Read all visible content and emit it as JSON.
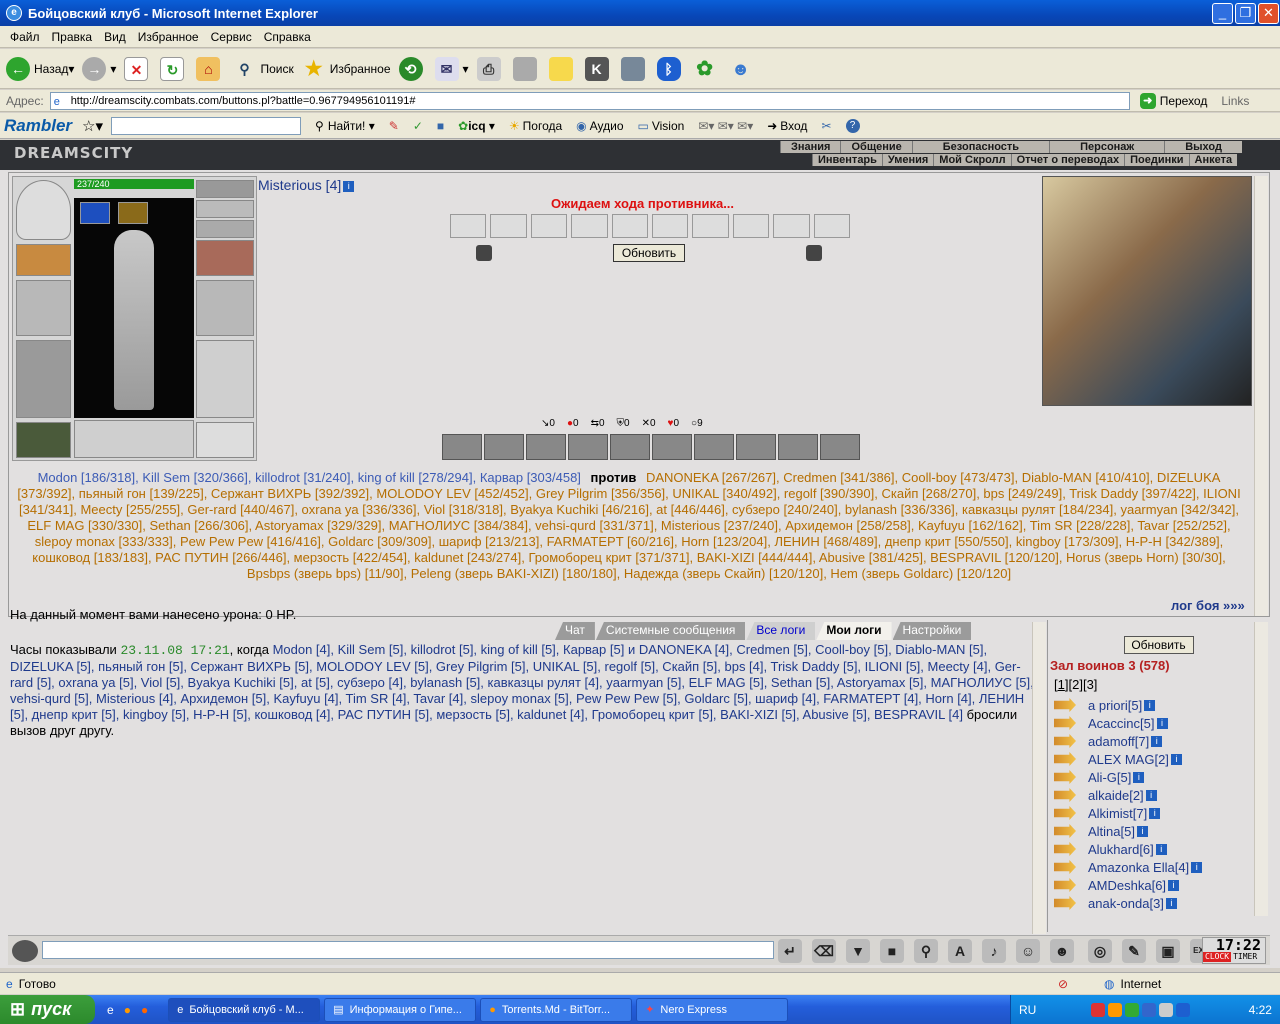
{
  "window": {
    "title": "Бойцовский клуб - Microsoft Internet Explorer"
  },
  "menu": [
    "Файл",
    "Правка",
    "Вид",
    "Избранное",
    "Сервис",
    "Справка"
  ],
  "toolbar": {
    "back": "Назад",
    "search": "Поиск",
    "favorites": "Избранное"
  },
  "address": {
    "label": "Адрес:",
    "url": "http://dreamscity.combats.com/buttons.pl?battle=0.967794956101191#",
    "go": "Переход",
    "links": "Links"
  },
  "rambler": {
    "logo": "Rambler",
    "find": "Найти!",
    "icq": "icq",
    "weather": "Погода",
    "audio": "Аудио",
    "vision": "Vision",
    "login": "Вход"
  },
  "game": {
    "logo": "DREAMSCITY",
    "nav_top": [
      "Знания",
      "Общение",
      "Безопасность",
      "Персонаж",
      "Выход"
    ],
    "nav_bottom": [
      "Инвентарь",
      "Умения",
      "Мой Скролл",
      "Отчет о переводах",
      "Поединки",
      "Анкета"
    ],
    "hp": "237/240",
    "opponent": "Misterious [4]",
    "waiting": "Ожидаем хода противника...",
    "refresh": "Обновить",
    "stats": [
      "0",
      "0",
      "0",
      "0",
      "0",
      "0",
      "9"
    ],
    "team1": "Modon [186/318], Kill Sem [320/366], killodrot [31/240], king of kill [278/294], Карвар [303/458]",
    "vs": "против",
    "team2": "DANONEKA [267/267], Credmen [341/386], Cooll-boy [473/473], Diablo-MAN [410/410], DIZELUKA [373/392], пьяный гон [139/225], Сержант ВИХРЬ [392/392], MOLODOY LEV [452/452], Grey Pilgrim [356/356], UNIKAL [340/492], regolf [390/390], Скайп [268/270], bps [249/249], Trisk Daddy [397/422], ILIONI [341/341], Meecty [255/255], Ger-rard [440/467], oxrana ya [336/336], Viol [318/318], Byakya Kuchiki [46/216], at [446/446], субзеро [240/240], bylanash [336/336], кавказцы рулят [184/234], yaarmyan [342/342], ELF MAG [330/330], Sethan [266/306], Astoryamax [329/329], МАГНОЛИУС [384/384], vehsi-qurd [331/371], Misterious [237/240], Архидемон [258/258], Kayfuyu [162/162], Tim SR [228/228], Tavar [252/252], slepoy monax [333/333], Pew Pew Pew [416/416], Goldarc [309/309], шариф [213/213], FARMATEPT [60/216], Horn [123/204], ЛЕНИН [468/489], днепр крит [550/550], kingboy [173/309], H-P-H [342/389], кошковод [183/183], РАС ПУТИН [266/446], мерзость [422/454], kaldunet [243/274], Громоборец крит [371/371], BAKI-XIZI [444/444], Abusive [381/425], BESPRAVIL [120/120], Horus (зверь Horn) [30/30], Bpsbps (зверь bps) [11/90], Peleng (зверь BAKI-XIZI) [180/180], Надежда (зверь Скайп) [120/120], Hem (зверь Goldarc) [120/120]",
    "damage": "На данный момент вами нанесено урона: 0 HP.",
    "log_link": "лог боя »»»",
    "tabs": [
      "Чат",
      "Системные сообщения",
      "Все логи",
      "Мои логи",
      "Настройки"
    ],
    "chat_time": "23.11.08 17:21",
    "chat_prefix": "Часы показывали",
    "chat_when": ", когда",
    "chat_text": "Modon [4], Kill Sem [5], killodrot [5], king of kill [5], Карвар [5] и DANONEKA [4], Credmen [5], Cooll-boy [5], Diablo-MAN [5], DIZELUKA [5], пьяный гон [5], Сержант ВИХРЬ [5], MOLODOY LEV [5], Grey Pilgrim [5], UNIKAL [5], regolf [5], Скайп [5], bps [4], Trisk Daddy [5], ILIONI [5], Meecty [4], Ger-rard [5], oxrana ya [5], Viol [5], Byakya Kuchiki [5], at [5], субзеро [4], bylanash [5], кавказцы рулят [4], yaarmyan [5], ELF MAG [5], Sethan [5], Astoryamax [5], МАГНОЛИУС [5], vehsi-qurd [5], Misterious [4], Архидемон [5], Kayfuyu [4], Tim SR [4], Tavar [4], slepoy monax [5], Pew Pew Pew [5], Goldarc [5], шариф [4], FARMATEPT [4], Horn [4], ЛЕНИН [5], днепр крит [5], kingboy [5], H-P-H [5], кошковод [4], РАС ПУТИН [5], мерзость [5], kaldunet [4], Громоборец крит [5], BAKI-XIZI [5], Abusive [5], BESPRAVIL [4]",
    "chat_suffix": "бросили вызов друг другу.",
    "room": {
      "refresh": "Обновить",
      "title": "Зал воинов 3 (578)",
      "pages": [
        "1",
        "2",
        "3"
      ],
      "users": [
        {
          "name": "a priori",
          "lvl": "[5]"
        },
        {
          "name": "Acaccinc",
          "lvl": "[5]"
        },
        {
          "name": "adamoff",
          "lvl": "[7]"
        },
        {
          "name": "ALEX MAG",
          "lvl": "[2]"
        },
        {
          "name": "Ali-G",
          "lvl": "[5]"
        },
        {
          "name": "alkaide",
          "lvl": "[2]"
        },
        {
          "name": "Alkimist",
          "lvl": "[7]"
        },
        {
          "name": "Altina",
          "lvl": "[5]"
        },
        {
          "name": "Alukhard",
          "lvl": "[6]"
        },
        {
          "name": "Amazonka Ella",
          "lvl": "[4]"
        },
        {
          "name": "AMDeshka",
          "lvl": "[6]"
        },
        {
          "name": "anak-onda",
          "lvl": "[3]"
        }
      ]
    },
    "clock": "17:22",
    "clock_label": "CLOCK",
    "timer_label": "TIMER"
  },
  "status": {
    "left": "Готово",
    "zone": "Internet"
  },
  "taskbar": {
    "start": "пуск",
    "tasks": [
      "Бойцовский клуб - М...",
      "Информация о Гипе...",
      "Torrents.Md - BitTorr...",
      "Nero Express"
    ],
    "lang": "RU",
    "time": "4:22"
  }
}
